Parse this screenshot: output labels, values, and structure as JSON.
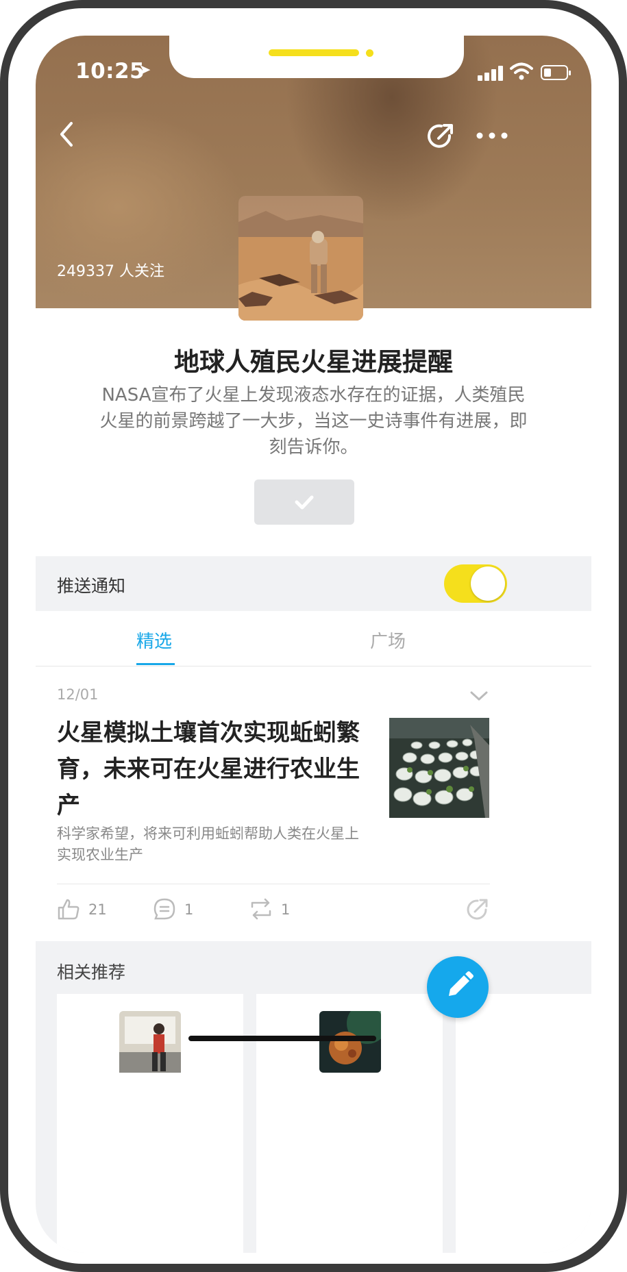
{
  "status_bar": {
    "time": "10:25"
  },
  "topic": {
    "followers": "249337 人关注",
    "title": "地球人殖民火星进展提醒",
    "description": "NASA宣布了火星上发现液态水存在的证据，人类殖民火星的前景跨越了一大步，当这一史诗事件有进展，即刻告诉你。"
  },
  "push": {
    "label": "推送通知",
    "enabled": true
  },
  "tabs": [
    {
      "label": "精选",
      "active": true
    },
    {
      "label": "广场",
      "active": false
    }
  ],
  "article": {
    "date": "12/01",
    "title": "火星模拟土壤首次实现蚯蚓繁育，未来可在火星进行农业生产",
    "summary": "科学家希望，将来可利用蚯蚓帮助人类在火星上实现农业生产",
    "likes": "21",
    "comments": "1",
    "reposts": "1"
  },
  "related": {
    "label": "相关推荐"
  },
  "colors": {
    "accent": "#17a7e8",
    "toggle": "#f5df1c",
    "hero": "#9a7656"
  }
}
